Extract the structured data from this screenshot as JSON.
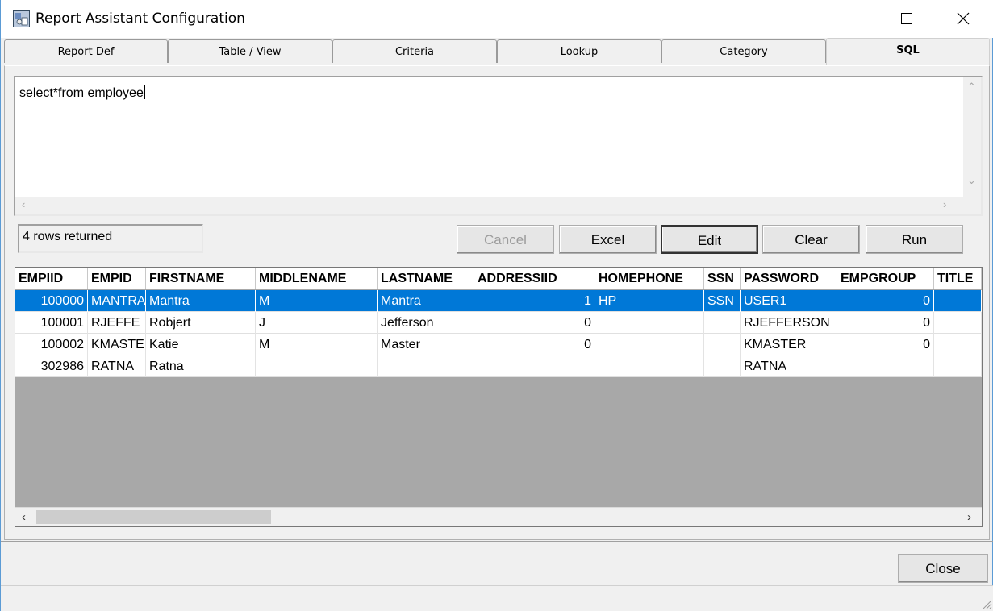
{
  "window": {
    "title": "Report Assistant Configuration"
  },
  "tabs": [
    {
      "label": "Report Def"
    },
    {
      "label": "Table / View"
    },
    {
      "label": "Criteria"
    },
    {
      "label": "Lookup"
    },
    {
      "label": "Category"
    },
    {
      "label": "SQL",
      "active": true
    }
  ],
  "sql": {
    "query": "select*from employee"
  },
  "status": {
    "text": "4 rows returned"
  },
  "buttons": {
    "cancel": "Cancel",
    "excel": "Excel",
    "edit": "Edit",
    "clear": "Clear",
    "run": "Run",
    "close": "Close"
  },
  "grid": {
    "columns": [
      "EMPIID",
      "EMPID",
      "FIRSTNAME",
      "MIDDLENAME",
      "LASTNAME",
      "ADDRESSIID",
      "HOMEPHONE",
      "SSN",
      "PASSWORD",
      "EMPGROUP",
      "TITLE"
    ],
    "rows": [
      [
        "100000",
        "MANTRA",
        "Mantra",
        "M",
        "Mantra",
        "1",
        "HP",
        "SSN",
        "USER1",
        "0",
        ""
      ],
      [
        "100001",
        "RJEFFE",
        "Robjert",
        "J",
        "Jefferson",
        "0",
        "",
        "",
        "RJEFFERSON",
        "0",
        ""
      ],
      [
        "100002",
        "KMASTE",
        "Katie",
        "M",
        "Master",
        "0",
        "",
        "",
        "KMASTER",
        "0",
        ""
      ],
      [
        "302986",
        "RATNA",
        "Ratna",
        "",
        "",
        "",
        "",
        "",
        "RATNA",
        "",
        ""
      ]
    ],
    "selected_row": 0
  }
}
